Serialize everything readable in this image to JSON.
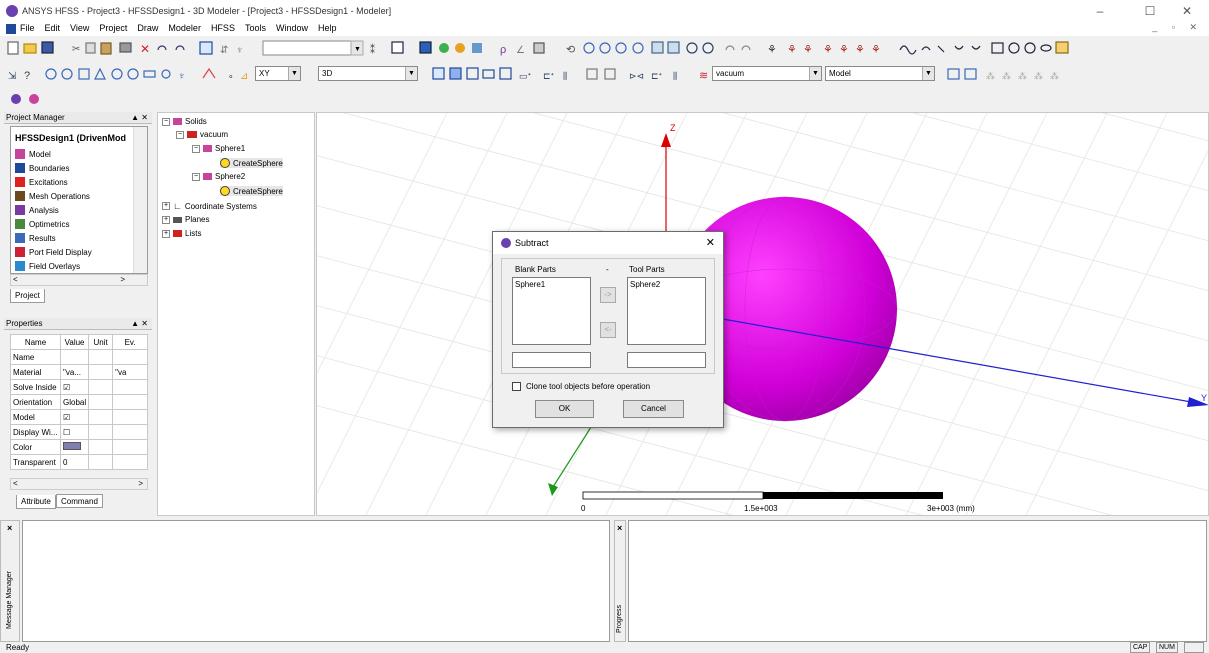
{
  "window": {
    "title": "ANSYS HFSS - Project3 - HFSSDesign1 - 3D Modeler - [Project3 - HFSSDesign1 - Modeler]",
    "minimize": "–",
    "maximize": "☐",
    "close": "✕"
  },
  "menu": {
    "items": [
      "File",
      "Edit",
      "View",
      "Project",
      "Draw",
      "Modeler",
      "HFSS",
      "Tools",
      "Window",
      "Help"
    ],
    "mdi_controls": "_ ▫ ✕"
  },
  "toolbar": {
    "plane_combo": "XY",
    "dim_combo": "3D",
    "material_combo": "vacuum",
    "model_combo": "Model",
    "combo_arrow": "▼"
  },
  "project_manager": {
    "header": "Project Manager",
    "pin": "▲ ✕",
    "root": "HFSSDesign1 (DrivenMod",
    "items": [
      "Model",
      "Boundaries",
      "Excitations",
      "Mesh Operations",
      "Analysis",
      "Optimetrics",
      "Results",
      "Port Field Display",
      "Field Overlays"
    ],
    "tab": "Project",
    "scroll_left": "<",
    "scroll_right": ">"
  },
  "properties": {
    "header": "Properties",
    "pin": "▲ ✕",
    "columns": [
      "Name",
      "Value",
      "Unit",
      "Ev."
    ],
    "rows": [
      {
        "name": "Name",
        "value": "",
        "unit": "",
        "ev": ""
      },
      {
        "name": "Material",
        "value": "\"va...",
        "unit": "",
        "ev": "\"va"
      },
      {
        "name": "Solve Inside",
        "value": "☑",
        "unit": "",
        "ev": ""
      },
      {
        "name": "Orientation",
        "value": "Global",
        "unit": "",
        "ev": ""
      },
      {
        "name": "Model",
        "value": "☑",
        "unit": "",
        "ev": ""
      },
      {
        "name": "Display Wi...",
        "value": "☐",
        "unit": "",
        "ev": ""
      },
      {
        "name": "Color",
        "value": "",
        "unit": "",
        "ev": ""
      },
      {
        "name": "Transparent",
        "value": "0",
        "unit": "",
        "ev": ""
      }
    ],
    "tabs": [
      "Attribute",
      "Command"
    ]
  },
  "tree": {
    "solids": "Solids",
    "vacuum": "vacuum",
    "sphere1": "Sphere1",
    "create1": "CreateSphere",
    "sphere2": "Sphere2",
    "create2": "CreateSphere",
    "coord": "Coordinate Systems",
    "planes": "Planes",
    "lists": "Lists"
  },
  "viewport": {
    "axis_z": "Z",
    "axis_y": "Y",
    "scale_0": "0",
    "scale_mid": "1.5e+003",
    "scale_end": "3e+003 (mm)",
    "sphere_color": "#d000d8"
  },
  "dialog": {
    "title": "Subtract",
    "close": "✕",
    "blank_label": "Blank Parts",
    "minus": "-",
    "tool_label": "Tool Parts",
    "blank_item": "Sphere1",
    "tool_item": "Sphere2",
    "move_right": "->",
    "move_left": "<-",
    "clone_label": "Clone tool objects before operation",
    "ok": "OK",
    "cancel": "Cancel"
  },
  "docks": {
    "message_manager": "Message Manager",
    "progress": "Progress",
    "close": "×"
  },
  "status": {
    "text": "Ready",
    "cap": "CAP",
    "num": "NUM"
  }
}
